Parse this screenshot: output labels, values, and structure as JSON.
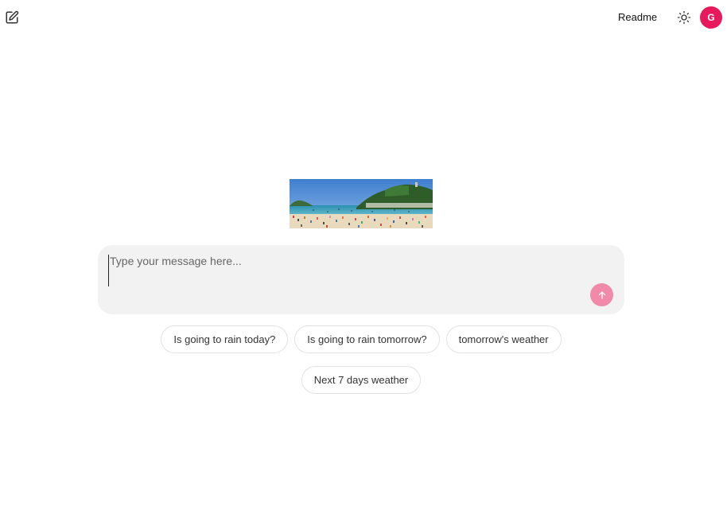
{
  "header": {
    "new_chat_icon": "edit-square-icon",
    "readme_label": "Readme",
    "theme_icon": "sun-icon",
    "avatar_initial": "G"
  },
  "hero": {
    "image_icon": "beach-photo"
  },
  "composer": {
    "placeholder": "Type your message here...",
    "value": "",
    "send_icon": "arrow-up-icon"
  },
  "suggestions": [
    {
      "label": "Is going to rain today?"
    },
    {
      "label": "Is going to rain tomorrow?"
    },
    {
      "label": "tomorrow's weather"
    },
    {
      "label": "Next 7 days weather"
    }
  ],
  "colors": {
    "accent": "#e8185d",
    "send_button": "#f08aa8",
    "composer_bg": "#f2f2f2",
    "chip_border": "#e2e2e2"
  }
}
